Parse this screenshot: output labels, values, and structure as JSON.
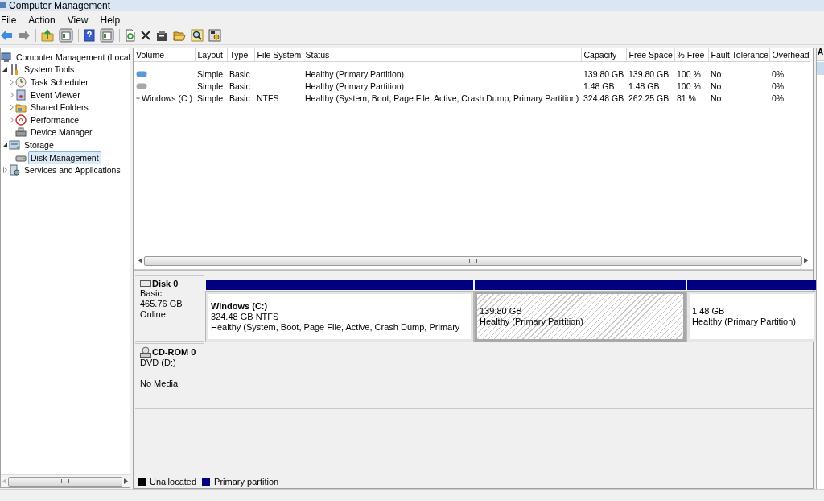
{
  "window": {
    "title": "Computer Management"
  },
  "menu": [
    {
      "label": "File"
    },
    {
      "label": "Action"
    },
    {
      "label": "View"
    },
    {
      "label": "Help"
    }
  ],
  "tree": {
    "items": [
      {
        "label": "Computer Management (Local",
        "selected": false,
        "children": [
          {
            "label": "System Tools",
            "selected": false,
            "expanded": true,
            "children": [
              {
                "label": "Task Scheduler",
                "selected": false,
                "expanded": false
              },
              {
                "label": "Event Viewer",
                "selected": false,
                "expanded": false
              },
              {
                "label": "Shared Folders",
                "selected": false,
                "expanded": false
              },
              {
                "label": "Performance",
                "selected": false,
                "expanded": false
              },
              {
                "label": "Device Manager",
                "selected": false
              }
            ]
          },
          {
            "label": "Storage",
            "selected": false,
            "expanded": true,
            "children": [
              {
                "label": "Disk Management",
                "selected": true
              }
            ]
          },
          {
            "label": "Services and Applications",
            "selected": false,
            "expanded": false
          }
        ]
      }
    ]
  },
  "volume_table": {
    "columns": [
      "Volume",
      "Layout",
      "Type",
      "File System",
      "Status",
      "Capacity",
      "Free Space",
      "% Free",
      "Fault Tolerance",
      "Overhead"
    ],
    "rows": [
      {
        "color": "#5b9bd5",
        "cells": [
          "",
          "Simple",
          "Basic",
          "",
          "Healthy (Primary Partition)",
          "139.80 GB",
          "139.80 GB",
          "100 %",
          "No",
          "0%"
        ]
      },
      {
        "color": "#a8a8a8",
        "cells": [
          "",
          "Simple",
          "Basic",
          "",
          "Healthy (Primary Partition)",
          "1.48 GB",
          "1.48 GB",
          "100 %",
          "No",
          "0%"
        ]
      },
      {
        "color": "#a8a8a8",
        "cells": [
          "Windows (C:)",
          "Simple",
          "Basic",
          "NTFS",
          "Healthy (System, Boot, Page File, Active, Crash Dump, Primary Partition)",
          "324.48 GB",
          "262.25 GB",
          "81 %",
          "No",
          "0%"
        ]
      }
    ]
  },
  "disks": [
    {
      "kind": "disk",
      "name": "Disk 0",
      "type": "Basic",
      "capacity": "465.76 GB",
      "status": "Online",
      "partitions": [
        {
          "selected": false,
          "color": "#000080",
          "title": "Windows  (C:)",
          "size": "324.48 GB NTFS",
          "status": "Healthy (System, Boot, Page File, Active, Crash Dump, Primary"
        },
        {
          "selected": true,
          "color": "#000080",
          "size": "139.80 GB",
          "status": "Healthy (Primary Partition)"
        },
        {
          "selected": false,
          "color": "#000080",
          "size": "1.48 GB",
          "status": "Healthy (Primary Partition)"
        }
      ]
    },
    {
      "kind": "cdrom",
      "name": "CD-ROM 0",
      "type": "DVD (D:)",
      "status": "No Media"
    }
  ],
  "legend": [
    {
      "label": "Unallocated",
      "color": "#000000"
    },
    {
      "label": "Primary partition",
      "color": "#000080"
    }
  ],
  "actions_pane": {
    "header": "A"
  }
}
